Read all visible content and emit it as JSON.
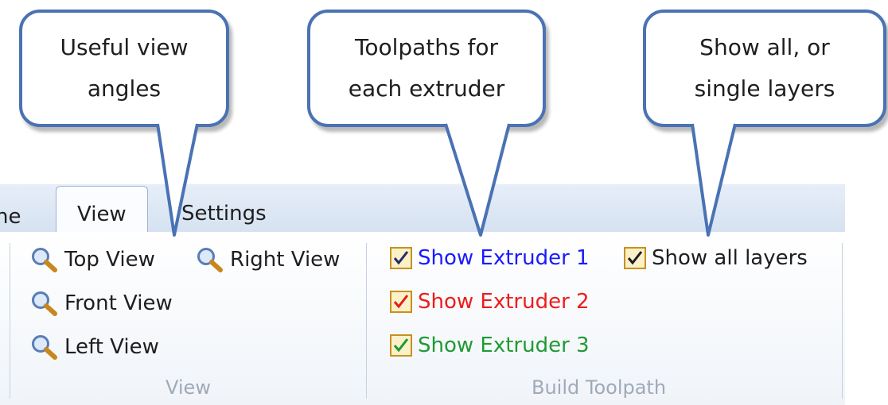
{
  "callouts": [
    {
      "text": "Useful view\nangles"
    },
    {
      "text": "Toolpaths for\neach extruder"
    },
    {
      "text": "Show all, or\nsingle layers"
    }
  ],
  "tabs": {
    "home_partial": "ne",
    "view": "View",
    "settings": "Settings"
  },
  "view_group": {
    "top": "Top View",
    "right": "Right View",
    "front": "Front View",
    "left": "Left View",
    "label": "View"
  },
  "toolpath_group": {
    "extruder1": "Show Extruder 1",
    "extruder2": "Show Extruder 2",
    "extruder3": "Show Extruder 3",
    "all_layers": "Show all layers",
    "label": "Build Toolpath"
  },
  "colors": {
    "extruder1": "#1a1aff",
    "extruder2": "#ee1c1c",
    "extruder3": "#1f9a35",
    "callout_border": "#4a72b4"
  },
  "icons": {
    "view_button": "magnifier-icon",
    "option_state": "checkbox-checked"
  }
}
